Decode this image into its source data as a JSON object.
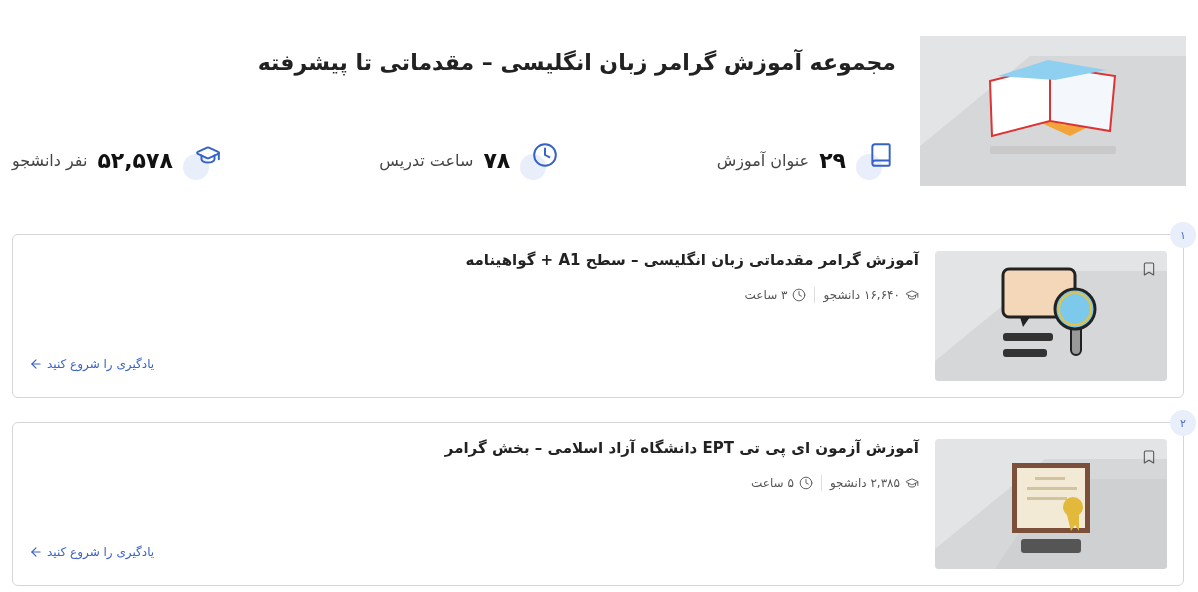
{
  "header": {
    "title": "مجموعه آموزش گرامر زبان انگلیسی – مقدماتی تا پیشرفته",
    "stats": [
      {
        "kind": "courses",
        "value": "۲۹",
        "label": "عنوان آموزش"
      },
      {
        "kind": "hours",
        "value": "۷۸",
        "label": "ساعت تدریس"
      },
      {
        "kind": "students",
        "value": "۵۲,۵۷۸",
        "label": "نفر دانشجو"
      }
    ]
  },
  "courses": [
    {
      "index": "۱",
      "title": "آموزش گرامر مقدماتی زبان انگلیسی – سطح A1 + گواهینامه",
      "students": "۱۶,۶۴۰ دانشجو",
      "duration": "۳ ساعت",
      "link": "یادگیری را شروع کنید"
    },
    {
      "index": "۲",
      "title": "آموزش آزمون ای پی تی EPT دانشگاه آزاد اسلامی – بخش گرامر",
      "students": "۲,۳۸۵ دانشجو",
      "duration": "۵ ساعت",
      "link": "یادگیری را شروع کنید"
    }
  ]
}
